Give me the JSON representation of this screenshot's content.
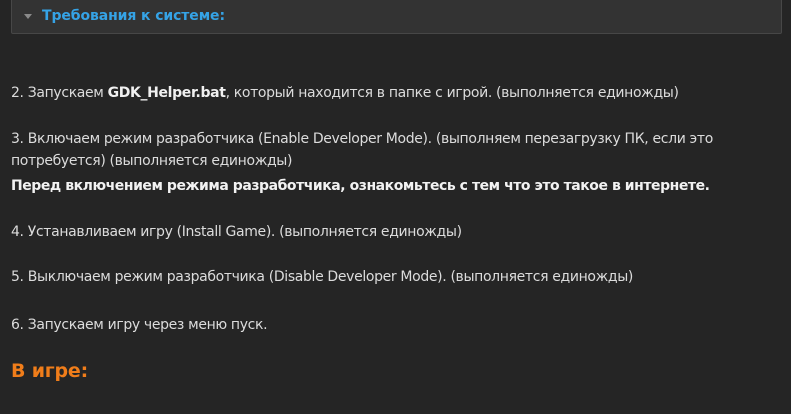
{
  "spoiler": {
    "title": "Требования к системе:",
    "arrow_icon": "triangle-down-icon",
    "title_color": "#35a3e6"
  },
  "steps": {
    "step2_prefix": "2. Запускаем ",
    "step2_file": "GDK_Helper.bat",
    "step2_suffix": ", который находится в папке с игрой. (выполняется единожды)",
    "step3_line1": "3. Включаем режим разработчика (Enable Developer Mode). (выполняем перезагрузку ПК, если это",
    "step3_line2": "потребуется) (выполняется единожды)",
    "step3_warning": "Перед включением режима разработчика, ознакомьтесь с тем что это такое в интернете.",
    "step4": "4. Устанавливаем игру (Install Game). (выполняется единожды)",
    "step5": "5. Выключаем режим разработчика (Disable Developer Mode). (выполняется единожды)",
    "step6": "6. Запускаем игру через меню пуск."
  },
  "section_heading": "В игре:",
  "colors": {
    "background": "#252525",
    "heading": "#f07d1a",
    "text": "#dcdcdc"
  }
}
